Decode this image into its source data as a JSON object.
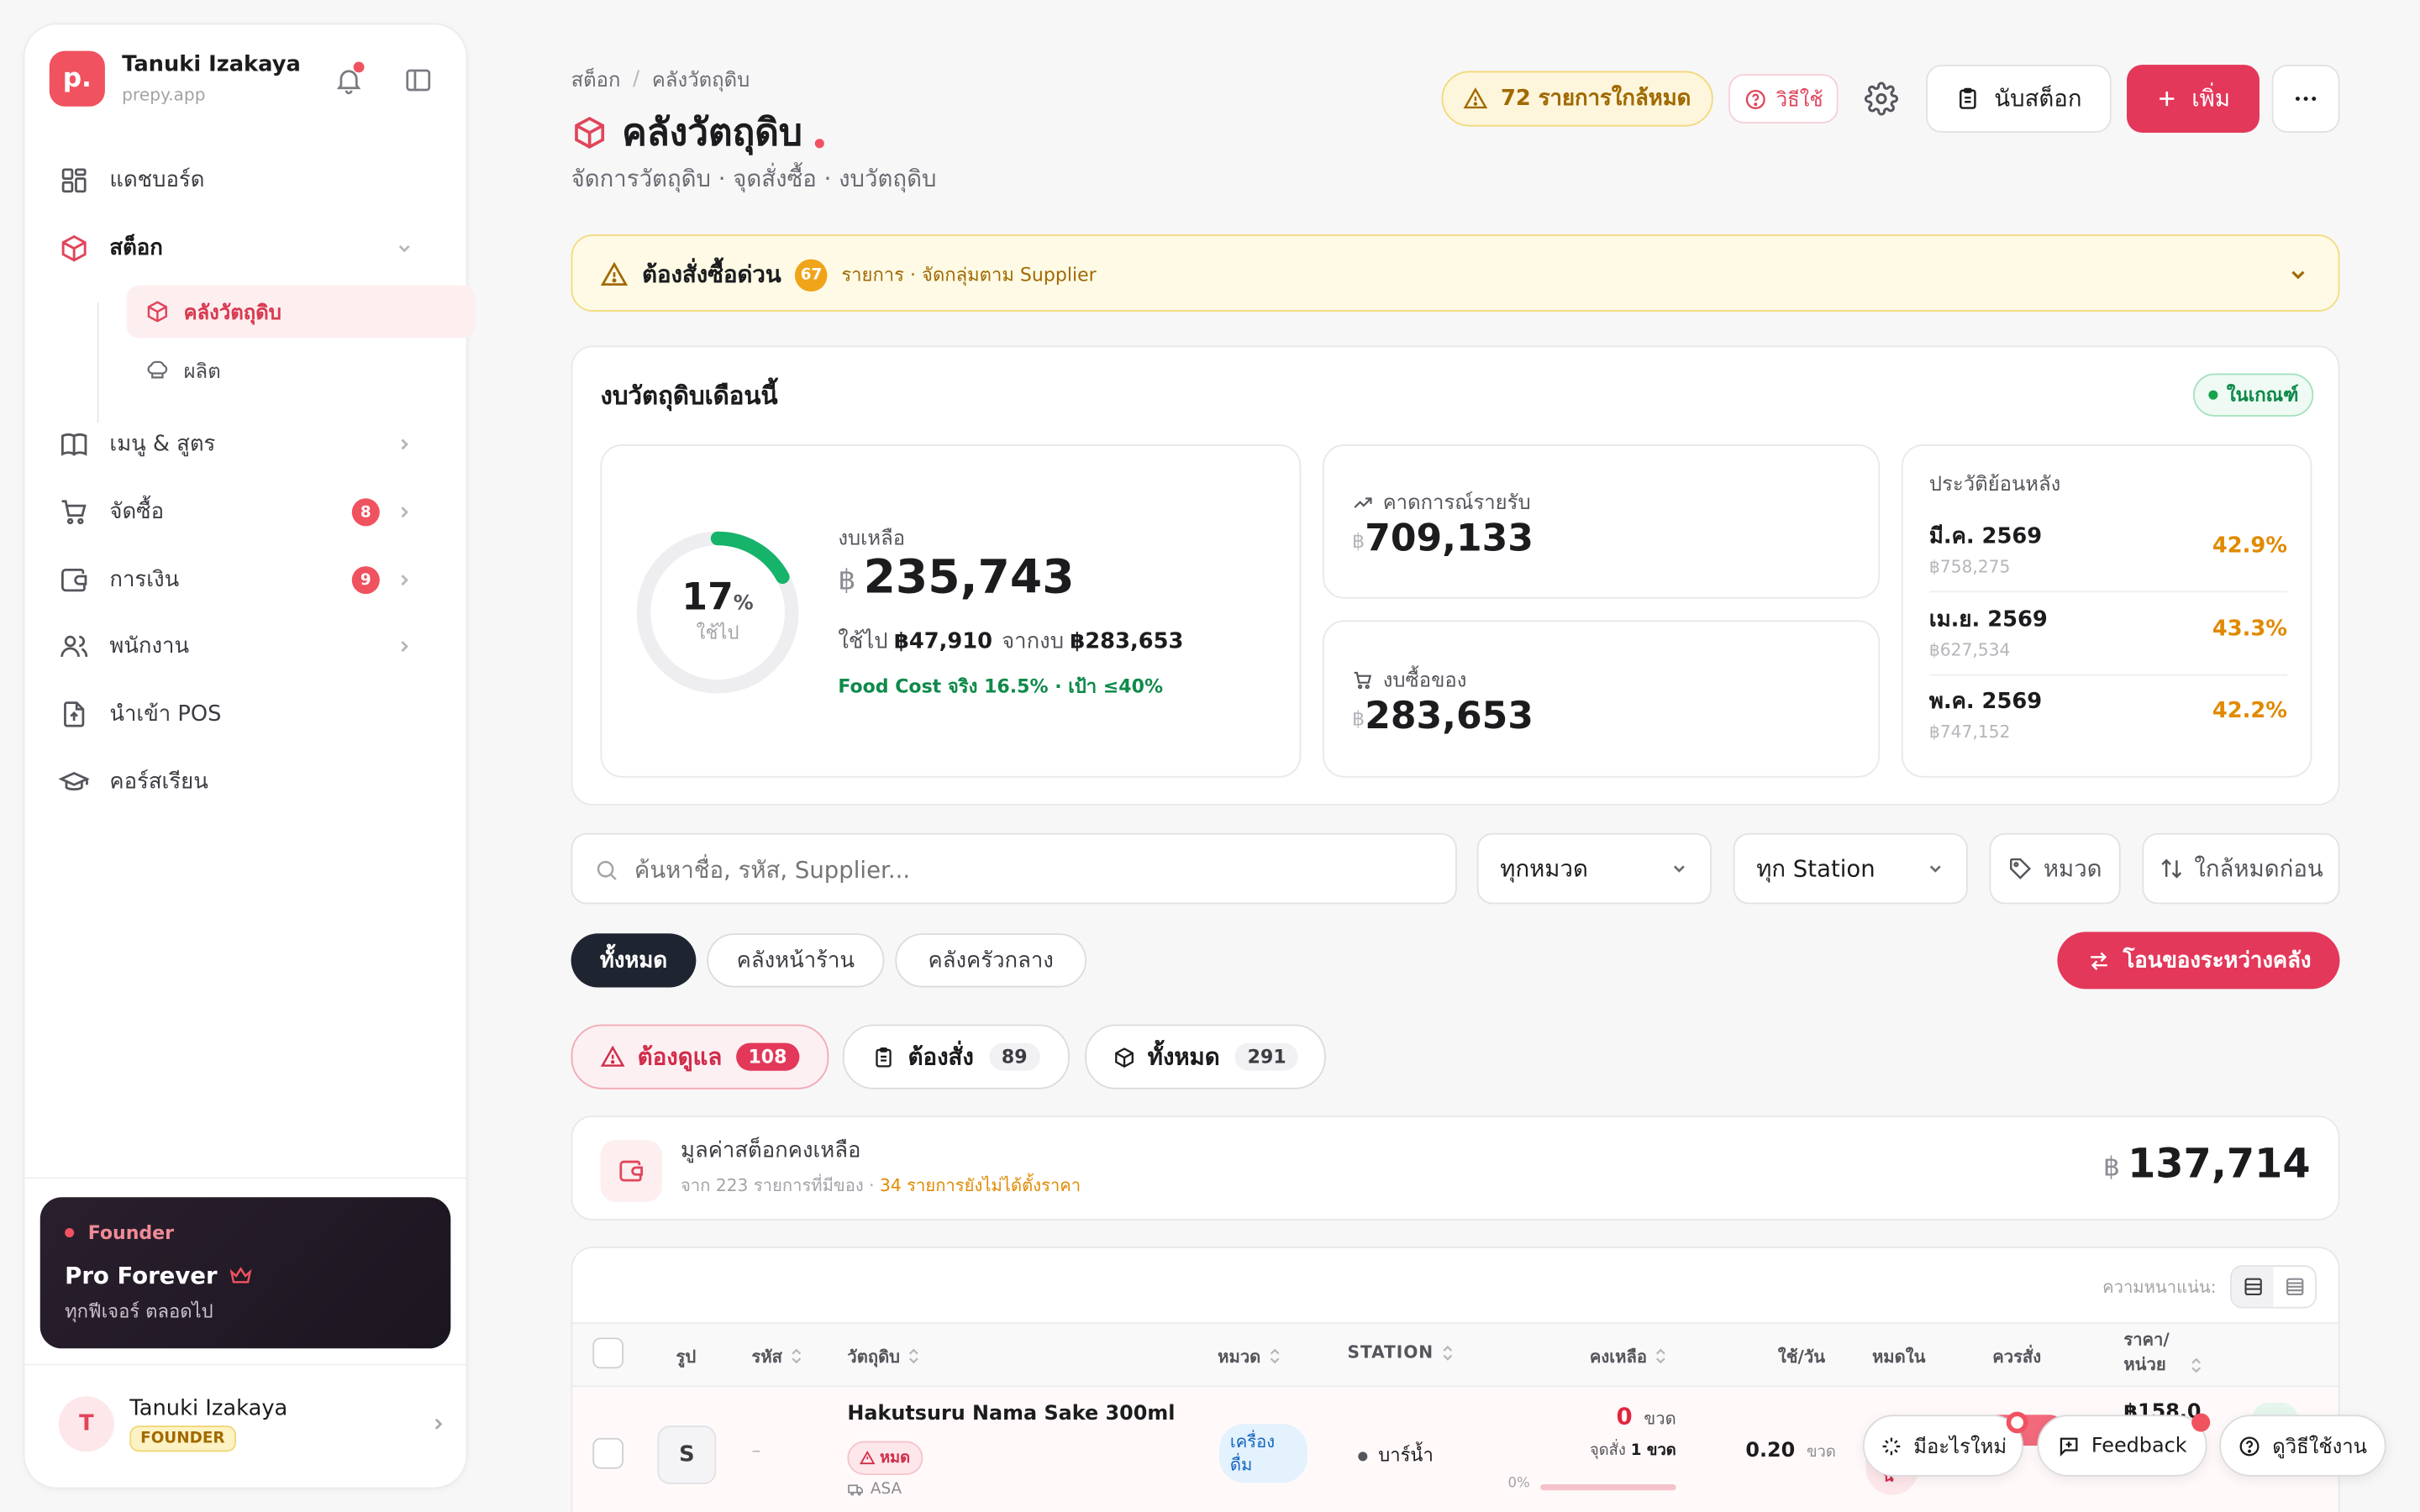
{
  "sidebar": {
    "logo_letter": "p.",
    "brand_name": "Tanuki Izakaya",
    "brand_sub": "prepy.app",
    "nav": [
      {
        "label": "แดชบอร์ด"
      },
      {
        "label": "สต็อก"
      },
      {
        "label": "เมนู & สูตร"
      },
      {
        "label": "จัดซื้อ",
        "badge": "8"
      },
      {
        "label": "การเงิน",
        "badge": "9"
      },
      {
        "label": "พนักงาน"
      },
      {
        "label": "นำเข้า POS"
      },
      {
        "label": "คอร์สเรียน"
      }
    ],
    "sub_items": [
      {
        "label": "คลังวัตถุดิบ"
      },
      {
        "label": "ผลิต"
      }
    ],
    "plan": {
      "tag": "Founder",
      "title": "Pro Forever",
      "desc": "ทุกฟีเจอร์ ตลอดไป"
    },
    "user": {
      "initial": "T",
      "name": "Tanuki Izakaya",
      "role": "FOUNDER"
    }
  },
  "header": {
    "breadcrumb_root": "สต็อก",
    "breadcrumb_sep": "/",
    "breadcrumb_current": "คลังวัตถุดิบ",
    "title": "คลังวัตถุดิบ",
    "subtitle": "จัดการวัตถุดิบ · จุดสั่งซื้อ · งบวัตถุดิบ",
    "low_stock_alert": "72 รายการใกล้หมด",
    "howto_label": "วิธีใช้",
    "count_stock_label": "นับสต็อก",
    "add_label": "เพิ่ม"
  },
  "urgent": {
    "title": "ต้องสั่งซื้อด่วน",
    "count": "67",
    "desc": "รายการ · จัดกลุ่มตาม Supplier"
  },
  "budget": {
    "title": "งบวัตถุดิบเดือนนี้",
    "status": "ในเกณฑ์",
    "percent": "17",
    "percent_sign": "%",
    "percent_value": 17,
    "used_caption": "ใช้ไป",
    "remaining_label": "งบเหลือ",
    "currency": "฿",
    "remaining": "235,743",
    "used_prefix": "ใช้ไป",
    "used_amount": "฿47,910",
    "of_label": "จากงบ",
    "total_amount": "฿283,653",
    "food_cost": "Food Cost จริง 16.5% · เป้า ≤40%",
    "forecast_label": "คาดการณ์รายรับ",
    "forecast_value": "709,133",
    "purchase_label": "งบซื้อของ",
    "purchase_value": "283,653",
    "history_title": "ประวัติย้อนหลัง",
    "history": [
      {
        "month": "มี.ค. 2569",
        "amount": "฿758,275",
        "pct": "42.9%"
      },
      {
        "month": "เม.ย. 2569",
        "amount": "฿627,534",
        "pct": "43.3%"
      },
      {
        "month": "พ.ค. 2569",
        "amount": "฿747,152",
        "pct": "42.2%"
      }
    ]
  },
  "filters": {
    "search_placeholder": "ค้นหาชื่อ, รหัส, Supplier...",
    "category_select": "ทุกหมวด",
    "station_select": "ทุก Station",
    "category_btn": "หมวด",
    "sort_btn": "ใกล้หมดก่อน"
  },
  "warehouse_tabs": [
    {
      "label": "ทั้งหมด"
    },
    {
      "label": "คลังหน้าร้าน"
    },
    {
      "label": "คลังครัวกลาง"
    }
  ],
  "transfer_label": "โอนของระหว่างคลัง",
  "status_tabs": [
    {
      "label": "ต้องดูแล",
      "count": "108"
    },
    {
      "label": "ต้องสั่ง",
      "count": "89"
    },
    {
      "label": "ทั้งหมด",
      "count": "291"
    }
  ],
  "stock_value": {
    "title": "มูลค่าสต็อกคงเหลือ",
    "desc_prefix": "จาก 223 รายการที่มีของ · ",
    "desc_warn": "34 รายการยังไม่ได้ตั้งราคา",
    "currency": "฿",
    "value": "137,714"
  },
  "table": {
    "density_label": "ความหนาแน่น:",
    "headers": {
      "image": "รูป",
      "code": "รหัส",
      "name": "วัตถุดิบ",
      "category": "หมวด",
      "station": "STATION",
      "remaining": "คงเหลือ",
      "use_per_day": "ใช้/วัน",
      "runout": "หมดใน",
      "should_order": "ควรสั่ง",
      "price_line1": "ราคา/",
      "price_line2": "หน่วย"
    },
    "rows": [
      {
        "initial": "S",
        "code": "–",
        "name": "Hakutsuru Nama Sake 300ml",
        "status_tag": "หมด",
        "supplier": "ASA",
        "category_line1": "เครื่อง",
        "category_line2": "ดื่ม",
        "station": "บาร์น้ำ",
        "remaining": "0",
        "unit": "ขวด",
        "reorder_prefix": "จุดสั่ง",
        "reorder_value": "1 ขวด",
        "level_pct_label": "0%",
        "use_per_day": "0.20",
        "use_unit": "ขวด",
        "price": "฿158.00",
        "runout_fragment": "น"
      }
    ]
  },
  "floating": {
    "whats_new": "มีอะไรใหม่",
    "feedback": "Feedback",
    "howto": "ดูวิธีใช้งาน"
  }
}
